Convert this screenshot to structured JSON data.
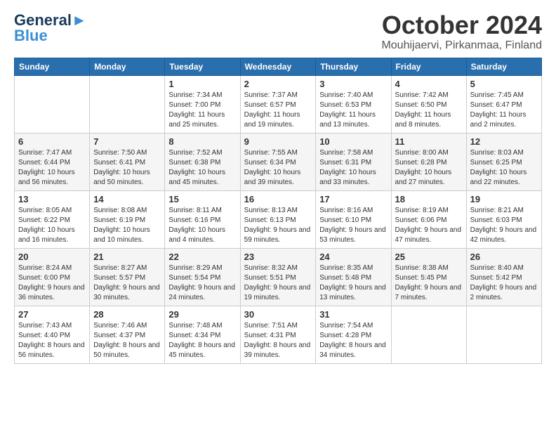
{
  "header": {
    "logo_line1": "General",
    "logo_line2": "Blue",
    "month": "October 2024",
    "location": "Mouhijaervi, Pirkanmaa, Finland"
  },
  "weekdays": [
    "Sunday",
    "Monday",
    "Tuesday",
    "Wednesday",
    "Thursday",
    "Friday",
    "Saturday"
  ],
  "weeks": [
    [
      {
        "day": "",
        "text": ""
      },
      {
        "day": "",
        "text": ""
      },
      {
        "day": "1",
        "text": "Sunrise: 7:34 AM\nSunset: 7:00 PM\nDaylight: 11 hours and 25 minutes."
      },
      {
        "day": "2",
        "text": "Sunrise: 7:37 AM\nSunset: 6:57 PM\nDaylight: 11 hours and 19 minutes."
      },
      {
        "day": "3",
        "text": "Sunrise: 7:40 AM\nSunset: 6:53 PM\nDaylight: 11 hours and 13 minutes."
      },
      {
        "day": "4",
        "text": "Sunrise: 7:42 AM\nSunset: 6:50 PM\nDaylight: 11 hours and 8 minutes."
      },
      {
        "day": "5",
        "text": "Sunrise: 7:45 AM\nSunset: 6:47 PM\nDaylight: 11 hours and 2 minutes."
      }
    ],
    [
      {
        "day": "6",
        "text": "Sunrise: 7:47 AM\nSunset: 6:44 PM\nDaylight: 10 hours and 56 minutes."
      },
      {
        "day": "7",
        "text": "Sunrise: 7:50 AM\nSunset: 6:41 PM\nDaylight: 10 hours and 50 minutes."
      },
      {
        "day": "8",
        "text": "Sunrise: 7:52 AM\nSunset: 6:38 PM\nDaylight: 10 hours and 45 minutes."
      },
      {
        "day": "9",
        "text": "Sunrise: 7:55 AM\nSunset: 6:34 PM\nDaylight: 10 hours and 39 minutes."
      },
      {
        "day": "10",
        "text": "Sunrise: 7:58 AM\nSunset: 6:31 PM\nDaylight: 10 hours and 33 minutes."
      },
      {
        "day": "11",
        "text": "Sunrise: 8:00 AM\nSunset: 6:28 PM\nDaylight: 10 hours and 27 minutes."
      },
      {
        "day": "12",
        "text": "Sunrise: 8:03 AM\nSunset: 6:25 PM\nDaylight: 10 hours and 22 minutes."
      }
    ],
    [
      {
        "day": "13",
        "text": "Sunrise: 8:05 AM\nSunset: 6:22 PM\nDaylight: 10 hours and 16 minutes."
      },
      {
        "day": "14",
        "text": "Sunrise: 8:08 AM\nSunset: 6:19 PM\nDaylight: 10 hours and 10 minutes."
      },
      {
        "day": "15",
        "text": "Sunrise: 8:11 AM\nSunset: 6:16 PM\nDaylight: 10 hours and 4 minutes."
      },
      {
        "day": "16",
        "text": "Sunrise: 8:13 AM\nSunset: 6:13 PM\nDaylight: 9 hours and 59 minutes."
      },
      {
        "day": "17",
        "text": "Sunrise: 8:16 AM\nSunset: 6:10 PM\nDaylight: 9 hours and 53 minutes."
      },
      {
        "day": "18",
        "text": "Sunrise: 8:19 AM\nSunset: 6:06 PM\nDaylight: 9 hours and 47 minutes."
      },
      {
        "day": "19",
        "text": "Sunrise: 8:21 AM\nSunset: 6:03 PM\nDaylight: 9 hours and 42 minutes."
      }
    ],
    [
      {
        "day": "20",
        "text": "Sunrise: 8:24 AM\nSunset: 6:00 PM\nDaylight: 9 hours and 36 minutes."
      },
      {
        "day": "21",
        "text": "Sunrise: 8:27 AM\nSunset: 5:57 PM\nDaylight: 9 hours and 30 minutes."
      },
      {
        "day": "22",
        "text": "Sunrise: 8:29 AM\nSunset: 5:54 PM\nDaylight: 9 hours and 24 minutes."
      },
      {
        "day": "23",
        "text": "Sunrise: 8:32 AM\nSunset: 5:51 PM\nDaylight: 9 hours and 19 minutes."
      },
      {
        "day": "24",
        "text": "Sunrise: 8:35 AM\nSunset: 5:48 PM\nDaylight: 9 hours and 13 minutes."
      },
      {
        "day": "25",
        "text": "Sunrise: 8:38 AM\nSunset: 5:45 PM\nDaylight: 9 hours and 7 minutes."
      },
      {
        "day": "26",
        "text": "Sunrise: 8:40 AM\nSunset: 5:42 PM\nDaylight: 9 hours and 2 minutes."
      }
    ],
    [
      {
        "day": "27",
        "text": "Sunrise: 7:43 AM\nSunset: 4:40 PM\nDaylight: 8 hours and 56 minutes."
      },
      {
        "day": "28",
        "text": "Sunrise: 7:46 AM\nSunset: 4:37 PM\nDaylight: 8 hours and 50 minutes."
      },
      {
        "day": "29",
        "text": "Sunrise: 7:48 AM\nSunset: 4:34 PM\nDaylight: 8 hours and 45 minutes."
      },
      {
        "day": "30",
        "text": "Sunrise: 7:51 AM\nSunset: 4:31 PM\nDaylight: 8 hours and 39 minutes."
      },
      {
        "day": "31",
        "text": "Sunrise: 7:54 AM\nSunset: 4:28 PM\nDaylight: 8 hours and 34 minutes."
      },
      {
        "day": "",
        "text": ""
      },
      {
        "day": "",
        "text": ""
      }
    ]
  ]
}
